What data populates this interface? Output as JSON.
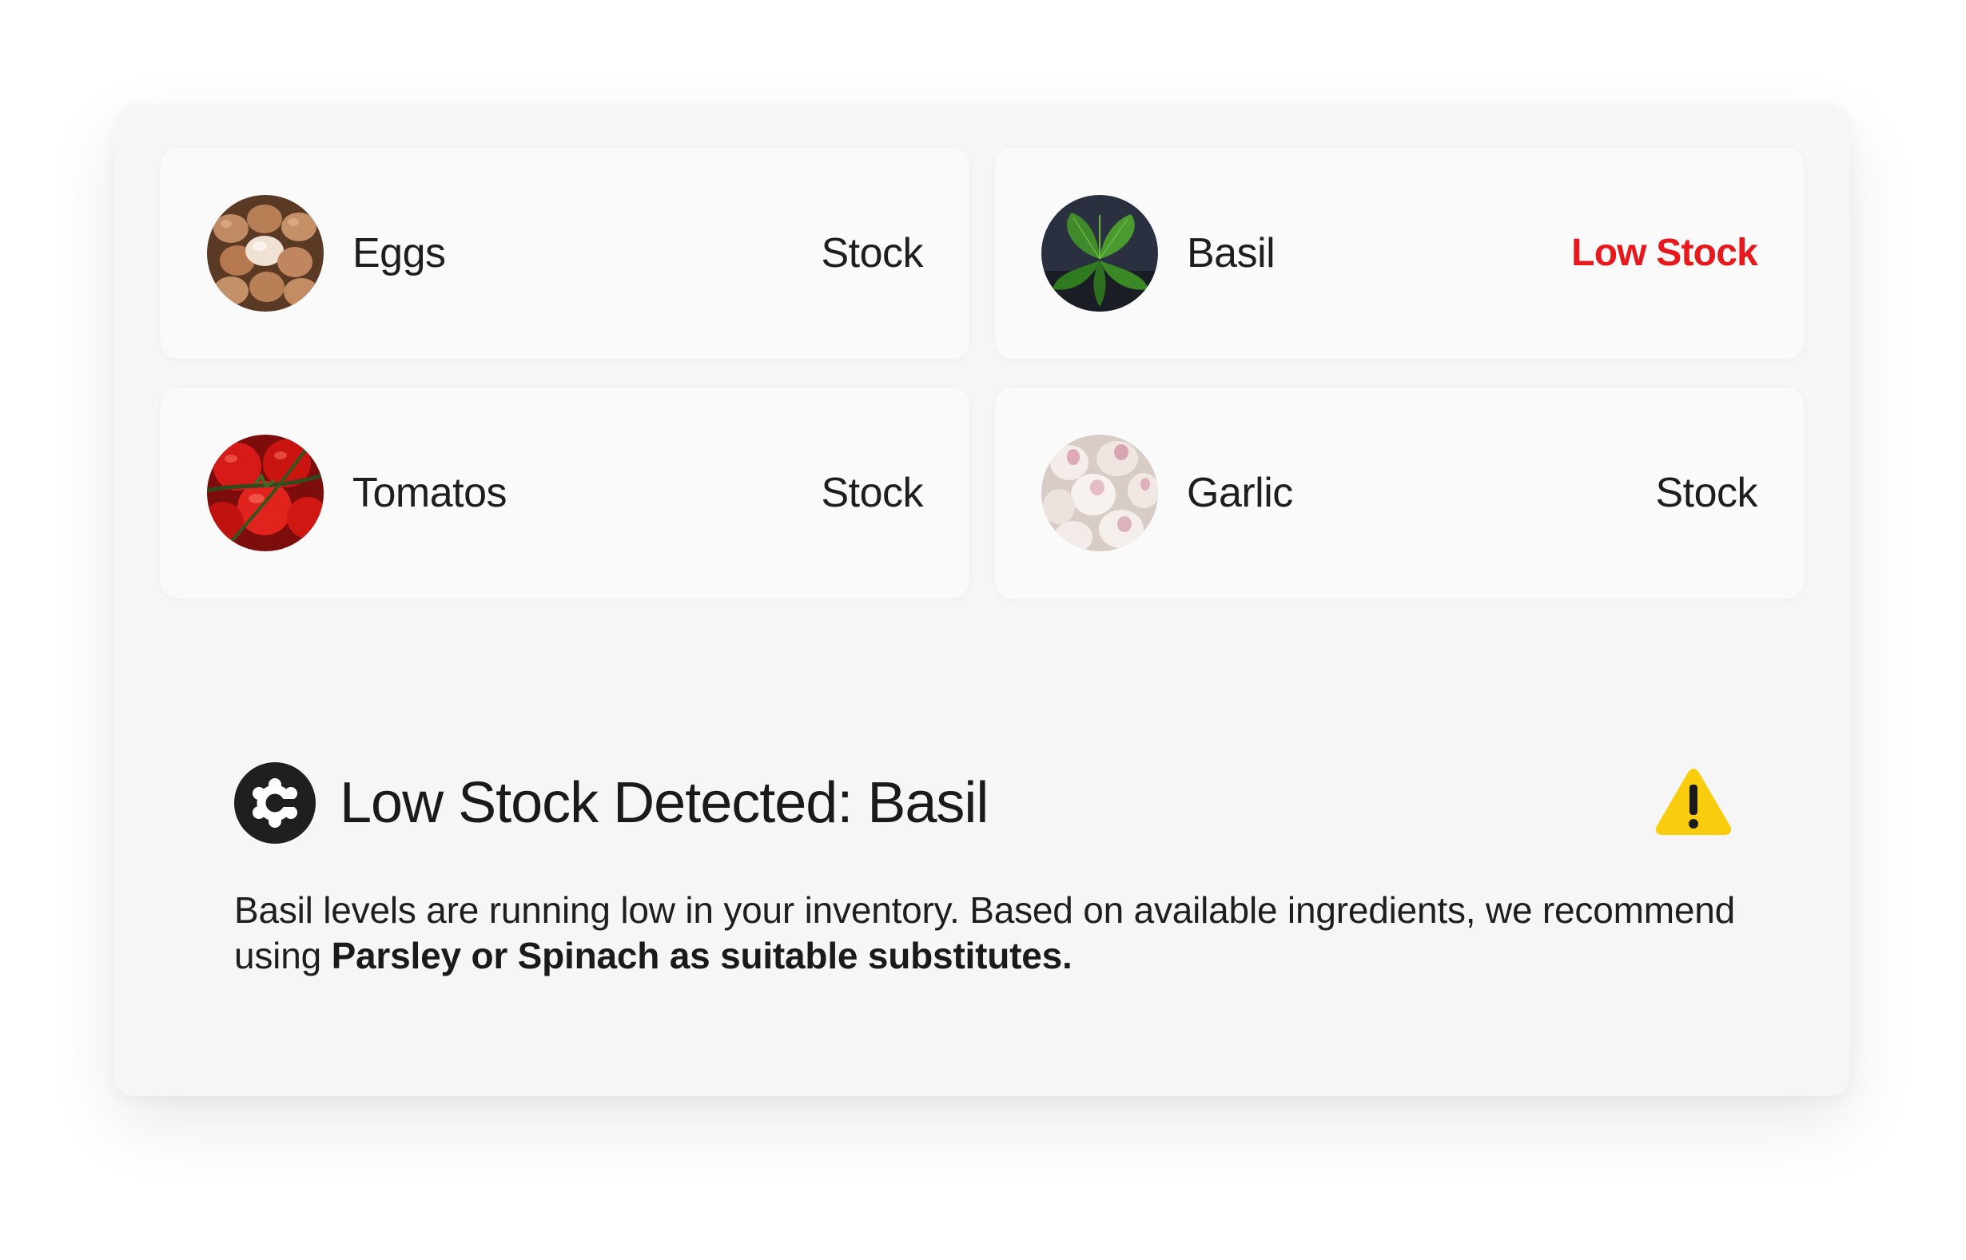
{
  "items": [
    {
      "name": "Eggs",
      "status": "Stock",
      "thumbnail_icon": "eggs-photo"
    },
    {
      "name": "Basil",
      "status": "Low Stock",
      "status_color": "#e8191c",
      "thumbnail_icon": "basil-photo"
    },
    {
      "name": "Tomatos",
      "status": "Stock",
      "thumbnail_icon": "tomatoes-photo"
    },
    {
      "name": "Garlic",
      "status": "Stock",
      "thumbnail_icon": "garlic-photo"
    }
  ],
  "alert": {
    "logo_icon": "assistant-logo-icon",
    "title": "Low Stock Detected: Basil",
    "warning_icon": "warning-triangle-icon",
    "body_text": "Basil levels are running low in your inventory. Based on available ingredients, we recommend using ",
    "body_emphasis": "Parsley or Spinach as suitable substitutes."
  },
  "colors": {
    "low_stock": "#e8191c",
    "warning": "#f9cd0d",
    "panel": "#f6f6f7",
    "card": "#fafafa"
  }
}
